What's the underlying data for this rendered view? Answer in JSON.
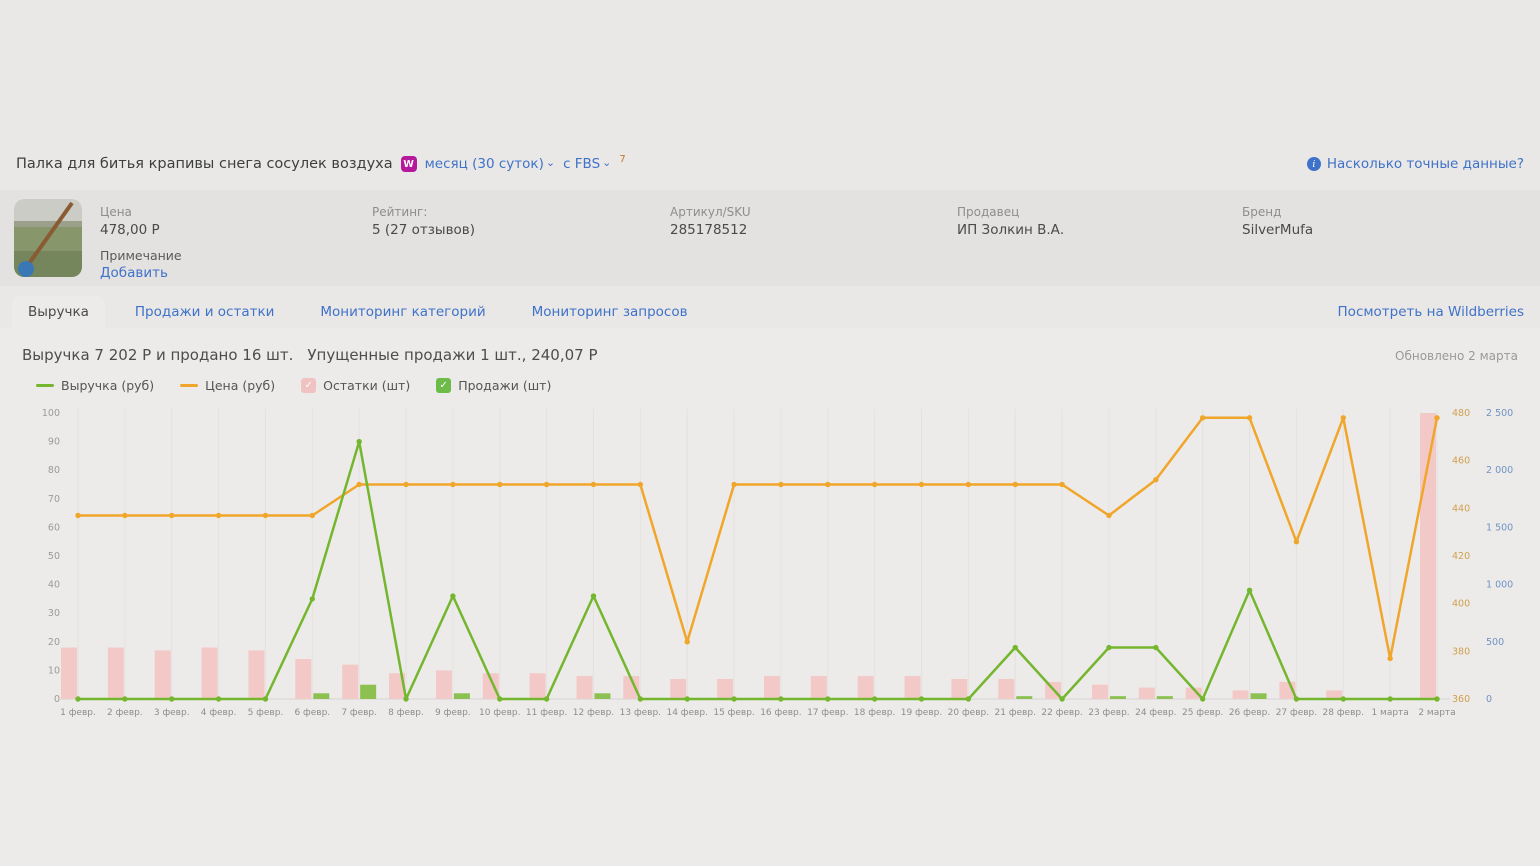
{
  "header": {
    "product_title": "Палка для битья крапивы снега сосулек воздуха",
    "marketplace_badge": "W",
    "period_dropdown": "месяц (30 суток)",
    "fbs_dropdown": "с FBS",
    "footnote": "7",
    "accuracy_link": "Насколько точные данные?"
  },
  "product": {
    "price_label": "Цена",
    "price_value": "478,00 Р",
    "note_label": "Примечание",
    "note_add_link": "Добавить",
    "rating_label": "Рейтинг:",
    "rating_value": "5 (27 отзывов)",
    "sku_label": "Артикул/SKU",
    "sku_value": "285178512",
    "seller_label": "Продавец",
    "seller_value": "ИП Золкин В.А.",
    "brand_label": "Бренд",
    "brand_value": "SilverMufa"
  },
  "tabs": {
    "items": [
      {
        "label": "Выручка",
        "active": true
      },
      {
        "label": "Продажи и остатки",
        "active": false
      },
      {
        "label": "Мониторинг категорий",
        "active": false
      },
      {
        "label": "Мониторинг запросов",
        "active": false
      }
    ],
    "view_link": "Посмотреть на Wildberries"
  },
  "panel": {
    "summary_revenue": "Выручка 7 202 Р и продано 16 шт.",
    "summary_missed": "Упущенные продажи 1 шт., 240,07 Р",
    "updated": "Обновлено 2 марта"
  },
  "legend": [
    {
      "label": "Выручка (руб)",
      "swatch": "line",
      "color": "#74b62e"
    },
    {
      "label": "Цена (руб)",
      "swatch": "line",
      "color": "#f0a62b"
    },
    {
      "label": "Остатки (шт)",
      "swatch": "checkbox",
      "color": "#f0c2c2"
    },
    {
      "label": "Продажи (шт)",
      "swatch": "checkbox",
      "color": "#6dbb49"
    }
  ],
  "chart_data": {
    "type": "composite",
    "categories": [
      "1 февр.",
      "2 февр.",
      "3 февр.",
      "4 февр.",
      "5 февр.",
      "6 февр.",
      "7 февр.",
      "8 февр.",
      "9 февр.",
      "10 февр.",
      "11 февр.",
      "12 февр.",
      "13 февр.",
      "14 февр.",
      "15 февр.",
      "16 февр.",
      "17 февр.",
      "18 февр.",
      "19 февр.",
      "20 февр.",
      "21 февр.",
      "22 февр.",
      "23 февр.",
      "24 февр.",
      "25 февр.",
      "26 февр.",
      "27 февр.",
      "28 февр.",
      "1 марта",
      "2 марта"
    ],
    "axes": {
      "units": {
        "side": "left",
        "min": 0,
        "max": 100,
        "color": "#9b9b99",
        "tick_labels": [
          "0",
          "10",
          "20",
          "30",
          "40",
          "50",
          "60",
          "70",
          "80",
          "90",
          "100"
        ]
      },
      "price": {
        "side": "right",
        "min": 360,
        "max": 480,
        "color": "#cfa04f",
        "tick_labels": [
          "360",
          "380",
          "400",
          "420",
          "440",
          "460",
          "480"
        ]
      },
      "revenue": {
        "side": "right2",
        "min": 0,
        "max": 2500,
        "color": "#6f93c4",
        "tick_labels": [
          "0",
          "500",
          "1 000",
          "1 500",
          "2 000",
          "2 500"
        ]
      }
    },
    "series": [
      {
        "name": "Остатки (шт)",
        "type": "bar",
        "axis": "units",
        "color": "#f3c9c8",
        "values": [
          18,
          18,
          17,
          18,
          17,
          14,
          12,
          9,
          10,
          9,
          9,
          8,
          8,
          7,
          7,
          8,
          8,
          8,
          8,
          7,
          7,
          6,
          5,
          4,
          4,
          3,
          6,
          3,
          0,
          100
        ]
      },
      {
        "name": "Продажи (шт)",
        "type": "bar",
        "axis": "units",
        "color": "#8cc152",
        "values": [
          0,
          0,
          0,
          0,
          0,
          2,
          5,
          0,
          2,
          0,
          0,
          2,
          0,
          0,
          0,
          0,
          0,
          0,
          0,
          0,
          1,
          0,
          1,
          1,
          0,
          2,
          0,
          0,
          0,
          0
        ]
      },
      {
        "name": "Цена (руб)",
        "type": "line",
        "axis": "price",
        "color": "#f0a62b",
        "values": [
          437,
          437,
          437,
          437,
          437,
          437,
          450,
          450,
          450,
          450,
          450,
          450,
          450,
          384,
          450,
          450,
          450,
          450,
          450,
          450,
          450,
          450,
          437,
          452,
          478,
          478,
          426,
          478,
          377,
          478
        ]
      },
      {
        "name": "Выручка (руб)",
        "type": "line",
        "axis": "revenue",
        "color": "#74b62e",
        "values": [
          0,
          0,
          0,
          0,
          0,
          875,
          2250,
          0,
          900,
          0,
          0,
          900,
          0,
          0,
          0,
          0,
          0,
          0,
          0,
          0,
          450,
          0,
          450,
          450,
          0,
          950,
          0,
          0,
          0,
          0
        ]
      }
    ],
    "grid": "vertical-faint",
    "legend_position": "top-left"
  }
}
